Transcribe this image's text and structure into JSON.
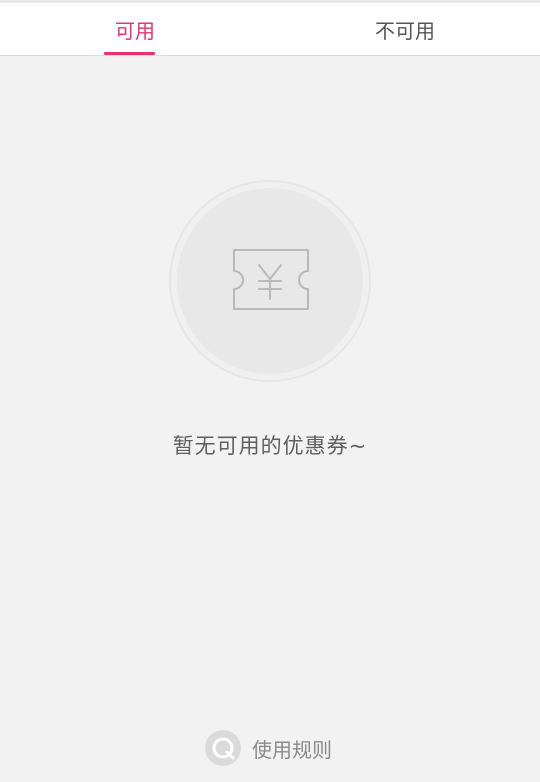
{
  "tabs": [
    {
      "label": "可用",
      "active": true
    },
    {
      "label": "不可用",
      "active": false
    }
  ],
  "empty_state": {
    "icon": "coupon-ticket-icon",
    "message": "暂无可用的优惠券~"
  },
  "footer": {
    "rules_label": "使用规则",
    "rules_icon": "question-bubble-icon"
  },
  "colors": {
    "accent": "#e8336d",
    "background": "#f2f2f2",
    "tab_inactive_text": "#555555",
    "empty_text": "#5f5f5f",
    "icon_gray": "#bdbdbd"
  }
}
